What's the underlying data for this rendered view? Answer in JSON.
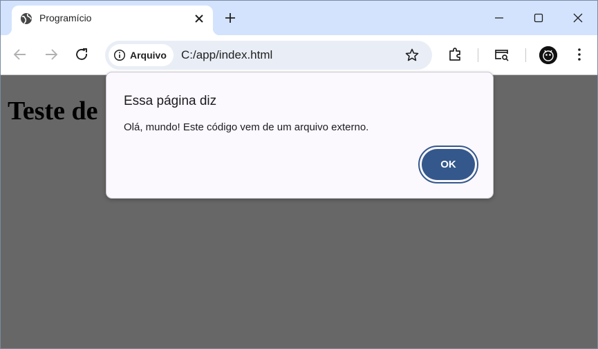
{
  "tab": {
    "title": "Programício"
  },
  "address_bar": {
    "security_chip": "Arquivo",
    "url": "C:/app/index.html"
  },
  "page": {
    "heading": "Teste de"
  },
  "dialog": {
    "title": "Essa página diz",
    "message": "Olá, mundo! Este código vem de um arquivo externo.",
    "ok_label": "OK"
  },
  "colors": {
    "accent": "#34588c",
    "frame": "#d3e3fd",
    "overlay": "#676767"
  },
  "icons": [
    "globe-icon",
    "close-icon",
    "plus-icon",
    "minimize-icon",
    "maximize-icon",
    "back-icon",
    "forward-icon",
    "reload-icon",
    "info-icon",
    "star-icon",
    "extensions-icon",
    "tab-search-icon",
    "menu-icon"
  ]
}
